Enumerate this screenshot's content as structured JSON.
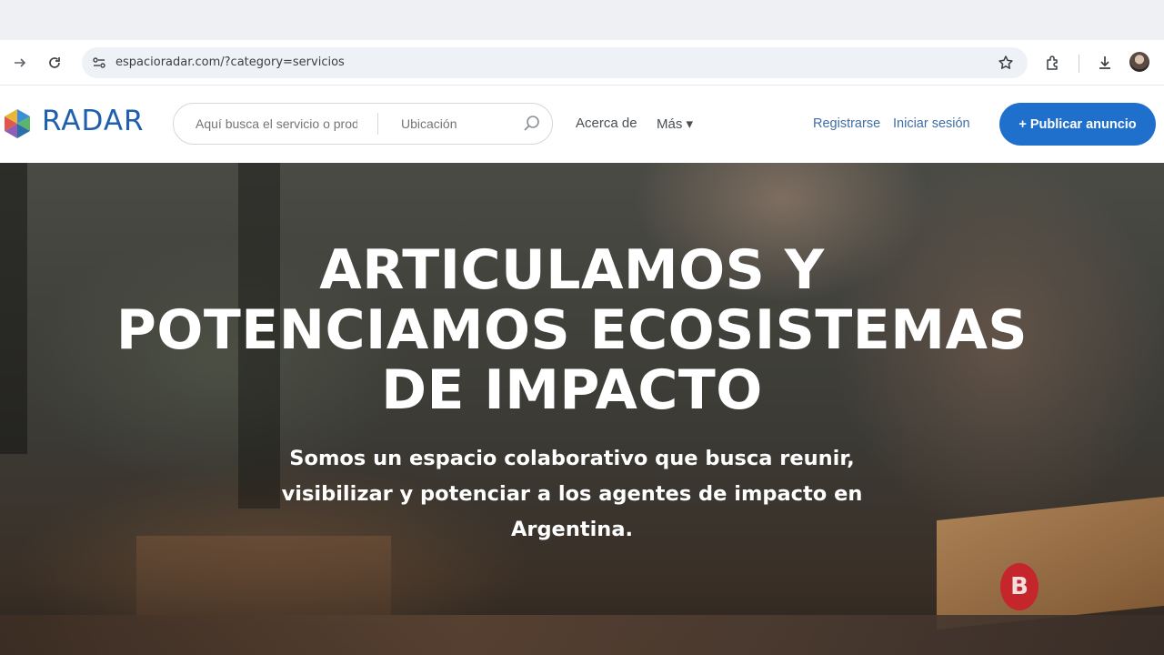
{
  "browser": {
    "url": "espacioradar.com/?category=servicios",
    "icons": [
      "forward-icon",
      "reload-icon",
      "site-settings-icon",
      "bookmark-star-icon",
      "extensions-icon",
      "download-icon",
      "profile-avatar"
    ]
  },
  "header": {
    "logo_text": "RADAR",
    "search": {
      "query_placeholder": "Aquí busca el servicio o producto",
      "location_placeholder": "Ubicación"
    },
    "nav": {
      "about": "Acerca de",
      "more": "Más ▾"
    },
    "auth": {
      "register": "Registrarse",
      "login": "Iniciar sesión"
    },
    "cta": "+ Publicar anuncio"
  },
  "hero": {
    "title_lines": [
      "ARTICULAMOS Y",
      "POTENCIAMOS ECOSISTEMAS",
      "DE IMPACTO"
    ],
    "subtitle_lines": [
      "Somos un espacio colaborativo que busca reunir,",
      "visibilizar y potenciar a los agentes de impacto en",
      "Argentina."
    ],
    "badge": "B"
  },
  "colors": {
    "brand_blue": "#1f5fae",
    "cta_blue": "#1f70cc",
    "link_blue": "#3f6ea6"
  }
}
